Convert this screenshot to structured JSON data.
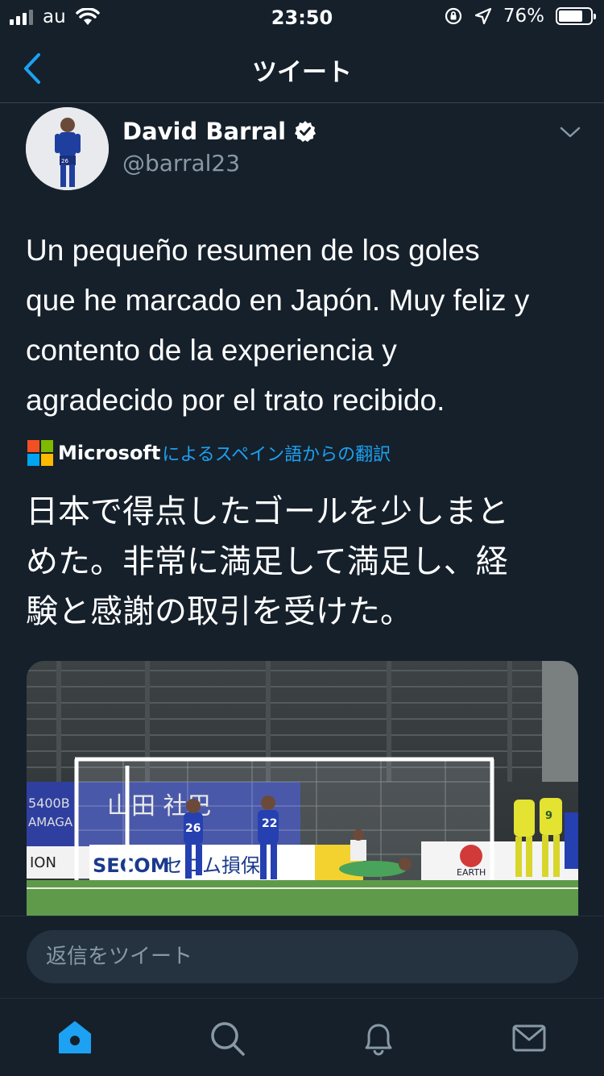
{
  "status_bar": {
    "carrier": "au",
    "time": "23:50",
    "battery_percent": "76%",
    "battery_level": 0.76
  },
  "nav": {
    "title": "ツイート"
  },
  "tweet": {
    "author_name": "David Barral",
    "author_handle": "@barral23",
    "verified": true,
    "text_lines": [
      "Un pequeño resumen de los goles",
      "que he marcado en Japón. Muy feliz y",
      "contento de la experiencia y",
      "agradecido por el trato recibido."
    ],
    "translation_provider": "Microsoft",
    "translation_note": "によるスペイン語からの翻訳",
    "translation_lines": [
      "日本で得点したゴールを少しまと",
      "めた。非常に満足して満足し、経",
      "験と感謝の取引を受けた。"
    ],
    "media": {
      "type": "video",
      "banners": [
        "5400B",
        "AMAGA",
        "ION",
        "SECOM",
        "セコム損保",
        "EARTH"
      ],
      "jersey_numbers": [
        "26",
        "22",
        "9"
      ]
    }
  },
  "reply": {
    "placeholder": "返信をツイート"
  },
  "tab_bar": {
    "items": [
      "home-icon",
      "search-icon",
      "notifications-icon",
      "messages-icon"
    ],
    "active": "home-icon"
  },
  "colors": {
    "background": "#15202b",
    "accent": "#1da1f2",
    "secondary_text": "#8899a6"
  }
}
